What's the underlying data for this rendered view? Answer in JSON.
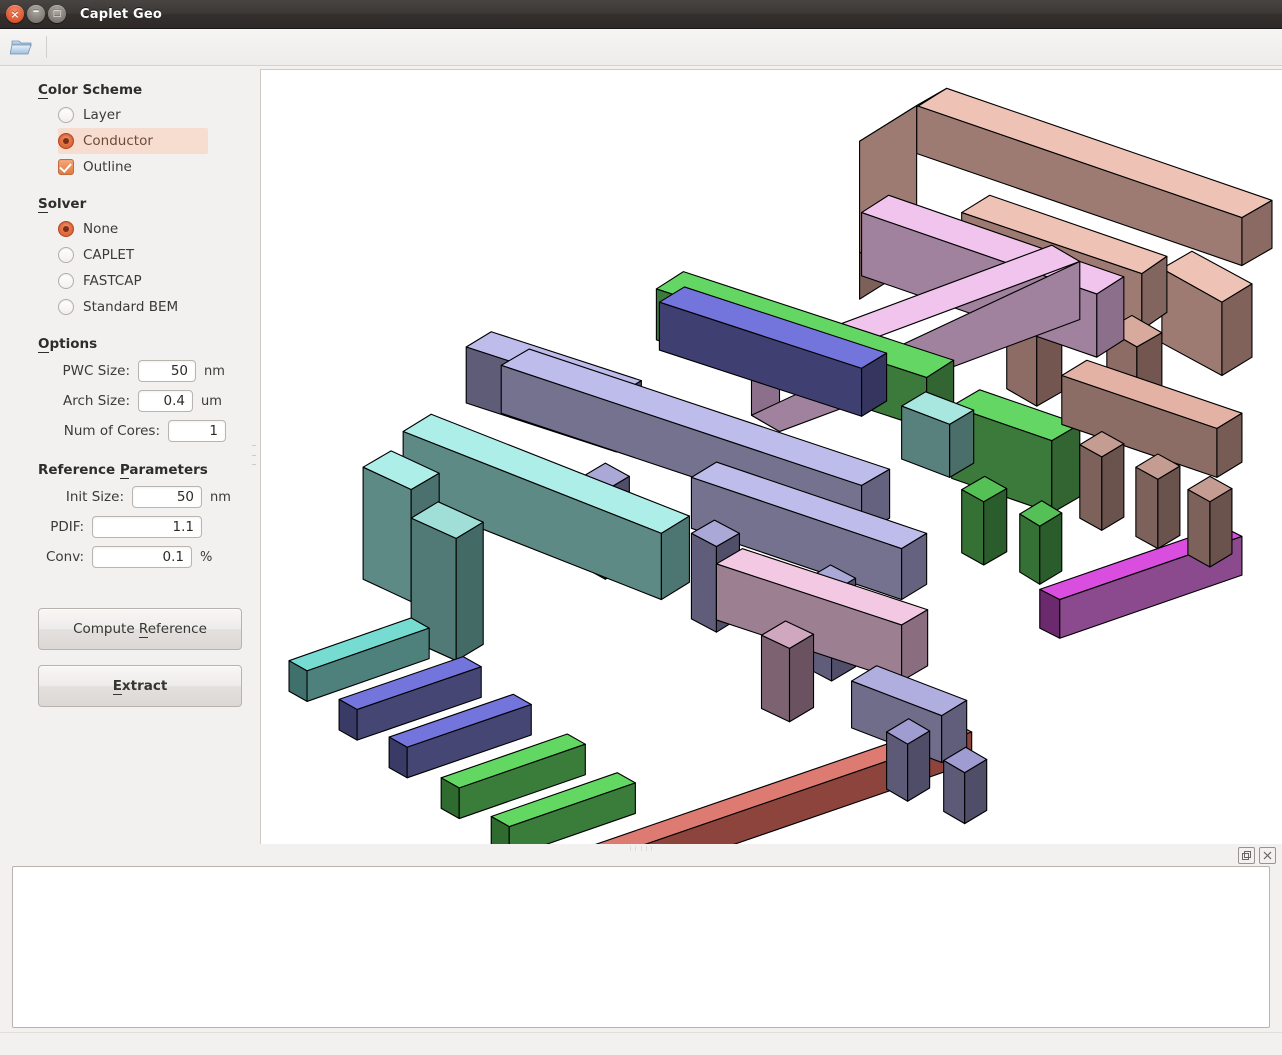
{
  "window": {
    "title": "Caplet Geo",
    "buttons": [
      {
        "name": "close",
        "glyph": "×"
      },
      {
        "name": "minimize",
        "glyph": "–"
      },
      {
        "name": "maximize",
        "glyph": "□"
      }
    ]
  },
  "toolbar": {
    "open_icon": "open-folder-icon",
    "open_tooltip": "Open"
  },
  "sidebar": {
    "color_scheme": {
      "title": "Color Scheme",
      "mnemonic": "C",
      "options": [
        {
          "label": "Layer",
          "selected": false,
          "type": "radio"
        },
        {
          "label": "Conductor",
          "selected": true,
          "type": "radio"
        },
        {
          "label": "Outline",
          "selected": true,
          "type": "checkbox"
        }
      ]
    },
    "solver": {
      "title": "Solver",
      "mnemonic": "S",
      "options": [
        {
          "label": "None",
          "selected": true
        },
        {
          "label": "CAPLET",
          "selected": false
        },
        {
          "label": "FASTCAP",
          "selected": false
        },
        {
          "label": "Standard BEM",
          "selected": false
        }
      ]
    },
    "options": {
      "title": "Options",
      "mnemonic": "O",
      "fields": [
        {
          "label": "PWC Size:",
          "value": "50",
          "unit": "nm"
        },
        {
          "label": "Arch Size:",
          "value": "0.4",
          "unit": "um"
        },
        {
          "label": "Num of Cores:",
          "value": "1",
          "unit": ""
        }
      ]
    },
    "reference_parameters": {
      "title_a": "Reference ",
      "title_mnemonic": "P",
      "title_b": "arameters",
      "fields": [
        {
          "label": "Init Size:",
          "value": "50",
          "unit": "nm"
        },
        {
          "label": "PDIF:",
          "value": "1.1",
          "unit": ""
        },
        {
          "label": "Conv:",
          "value": "0.1",
          "unit": "%"
        }
      ]
    },
    "buttons": [
      {
        "pre": "Compute ",
        "mn": "R",
        "post": "eference",
        "default": false
      },
      {
        "pre": "",
        "mn": "E",
        "post": "xtract",
        "default": true
      }
    ]
  },
  "dock": {
    "float_icon": "float-window-icon",
    "close_icon": "close-icon",
    "float_glyph": "⧉",
    "close_glyph": "☒"
  },
  "console": {
    "text": ""
  },
  "viewport": {
    "background": "#ffffff",
    "name": "3d-geometry-viewport",
    "projection": "isometric",
    "palette": {
      "salmon": "#e8b5a8",
      "pink": "#eec0e6",
      "lavender": "#b6b4e0",
      "periwinkle": "#a6a5d4",
      "cyan": "#a8e6e0",
      "teal": "#8fcfc4",
      "green": "#63d463",
      "blue": "#6e6ed8",
      "mauve": "#a58fae",
      "magenta": "#cc4fd0",
      "red": "#c25c52",
      "brown": "#8d7068"
    }
  }
}
